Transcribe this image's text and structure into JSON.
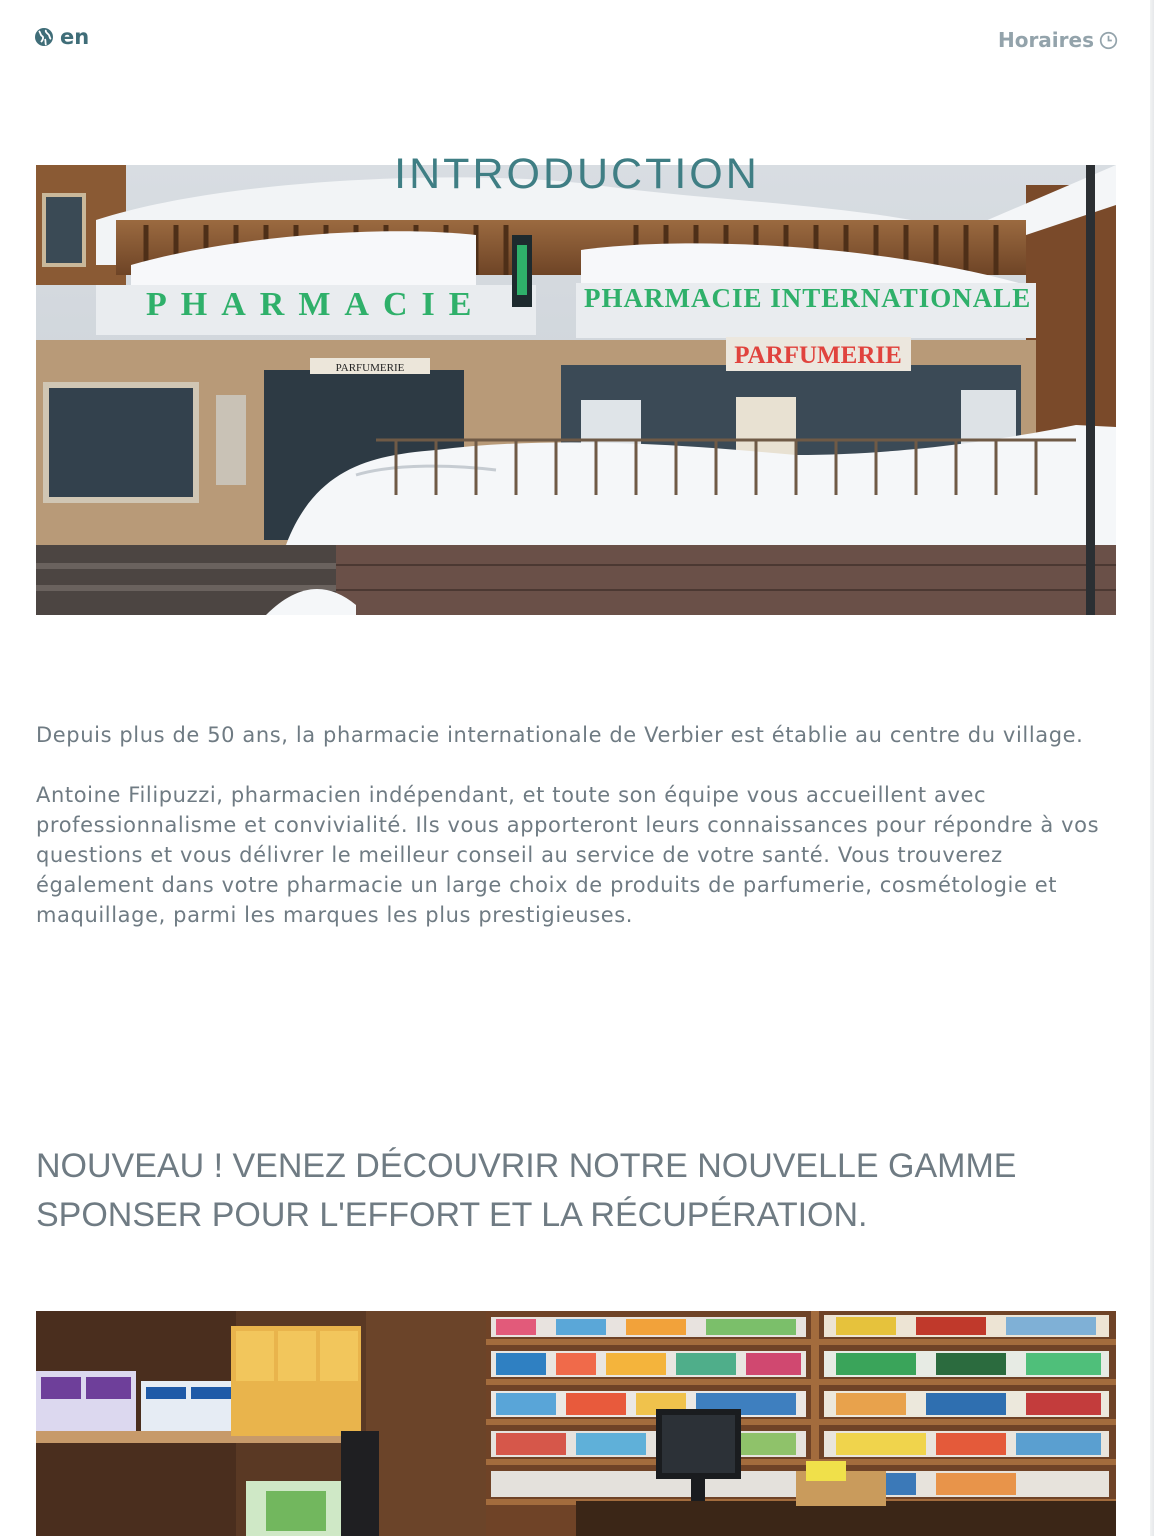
{
  "header": {
    "language_label": "en",
    "hours_label": "Horaires"
  },
  "intro": {
    "title": "INTRODUCTION",
    "paragraphs": [
      "Depuis plus de 50 ans, la pharmacie internationale de Verbier est établie au centre du village.",
      "Antoine Filipuzzi, pharmacien indépendant, et toute son équipe vous accueillent avec professionnalisme et convivialité. Ils vous apporteront leurs connaissances pour répondre à vos questions et vous délivrer le meilleur conseil au service de votre santé. Vous trouverez également dans votre pharmacie un large choix de produits de parfumerie, cosmétologie et maquillage, parmi les marques les plus prestigieuses."
    ]
  },
  "storefront": {
    "sign_left": "PHARMACIE",
    "sign_main": "PHARMACIE INTERNATIONALE",
    "sign_parfumerie": "PARFUMERIE",
    "sign_small": "PARFUMERIE"
  },
  "promo": {
    "heading": "NOUVEAU ! VENEZ DÉCOUVRIR NOTRE NOUVELLE GAMME SPONSER POUR L'EFFORT ET LA RÉCUPÉRATION."
  },
  "colors": {
    "accent_teal": "#3f7e84",
    "text_gray": "#6f7b83",
    "sign_green": "#2fb06a",
    "sign_red": "#e0433d"
  },
  "icons": {
    "language": "globe-icon",
    "hours": "clock-icon"
  }
}
